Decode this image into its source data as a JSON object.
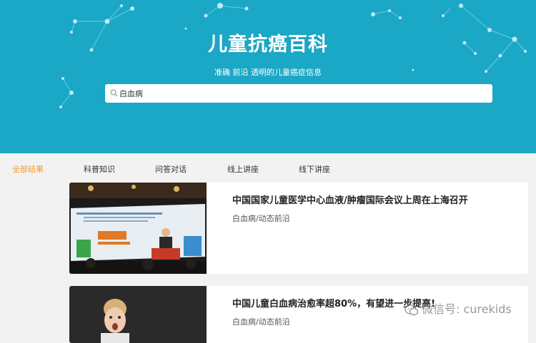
{
  "header": {
    "title": "儿童抗癌百科",
    "subtitle": "准确 前沿 透明的儿童癌症信息"
  },
  "search": {
    "value": "白血病",
    "icon": "search-icon"
  },
  "tabs": [
    {
      "label": "全部结果",
      "active": true
    },
    {
      "label": "科普知识",
      "active": false
    },
    {
      "label": "问答对话",
      "active": false
    },
    {
      "label": "线上讲座",
      "active": false
    },
    {
      "label": "线下讲座",
      "active": false
    }
  ],
  "results": [
    {
      "title": "中国国家儿童医学中心血液/肿瘤国际会议上周在上海召开",
      "tag": "白血病/动态前沿"
    },
    {
      "title": "中国儿童白血病治愈率超80%，有望进一步提高!",
      "tag": "白血病/动态前沿"
    }
  ],
  "watermark": {
    "text": "微信号: curekids"
  },
  "colors": {
    "hero": "#1ba7c6",
    "accent": "#f39a1e"
  }
}
